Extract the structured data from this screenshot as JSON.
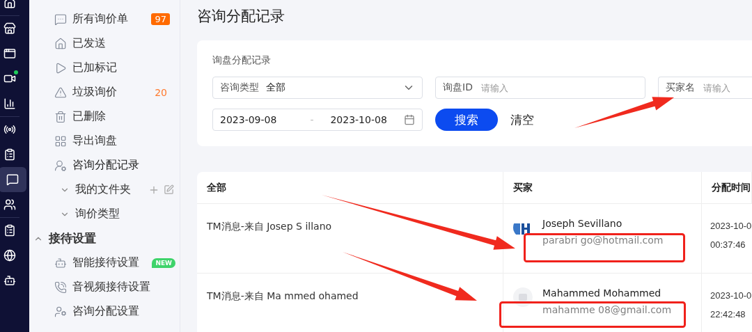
{
  "rail": {
    "items": [
      {
        "selected": false,
        "dot": false
      },
      {
        "selected": false,
        "dot": false
      },
      {
        "selected": false,
        "dot": false
      },
      {
        "selected": false,
        "dot": true
      },
      {
        "selected": false,
        "dot": false
      },
      {
        "selected": false,
        "dot": false
      },
      {
        "selected": false,
        "dot": false
      },
      {
        "selected": true,
        "dot": false
      },
      {
        "selected": false,
        "dot": false
      },
      {
        "selected": false,
        "dot": false
      },
      {
        "selected": false,
        "dot": false
      },
      {
        "selected": false,
        "dot": false
      }
    ]
  },
  "sidebar": {
    "items": [
      {
        "kind": "item",
        "label": "所有询价单",
        "count": {
          "text": "97",
          "kind": "badge"
        },
        "selected": false
      },
      {
        "kind": "item",
        "label": "已发送",
        "selected": false
      },
      {
        "kind": "item",
        "label": "已加标记",
        "selected": false
      },
      {
        "kind": "item",
        "label": "垃圾询价",
        "count": {
          "text": "20",
          "kind": "plain"
        },
        "selected": false
      },
      {
        "kind": "item",
        "label": "已删除",
        "selected": false
      },
      {
        "kind": "item",
        "label": "导出询盘",
        "selected": false
      },
      {
        "kind": "item",
        "label": "咨询分配记录",
        "selected": true
      },
      {
        "kind": "folder",
        "label": "我的文件夹",
        "expanded": false,
        "actions": true
      },
      {
        "kind": "folder",
        "label": "询价类型",
        "expanded": false,
        "actions": false
      },
      {
        "kind": "section",
        "label": "接待设置",
        "expanded": true
      },
      {
        "kind": "item",
        "label": "智能接待设置",
        "tag": "NEW",
        "selected": false
      },
      {
        "kind": "item",
        "label": "音视频接待设置",
        "selected": false
      },
      {
        "kind": "item",
        "label": "咨询分配设置",
        "selected": false
      }
    ]
  },
  "page_title": "咨询分配记录",
  "filters": {
    "title": "询盘分配记录",
    "type_select": {
      "label": "咨询类型",
      "value": "全部"
    },
    "id_field": {
      "label": "询盘ID",
      "placeholder": "请输入"
    },
    "buyer_field": {
      "label": "买家名",
      "placeholder": "请输入"
    },
    "date_range": {
      "start": "2023-09-08",
      "separator": "-",
      "end": "2023-10-08"
    },
    "search_button": "搜索",
    "clear_button": "清空"
  },
  "table": {
    "columns": [
      "全部",
      "买家",
      "分配时间"
    ],
    "rows": [
      {
        "subject": "TM消息-来自 Josep S illano",
        "buyer_name": "Joseph Sevillano",
        "buyer_email": "parabri go@hotmail.com",
        "avatar": {
          "kind": "logo"
        },
        "date": "2023-10-0",
        "time": "00:37:46"
      },
      {
        "subject": "TM消息-来自 Ma mmed ohamed",
        "buyer_name": "Mahammed Mohammed",
        "buyer_email": "mahamme 08@gmail.com",
        "avatar": {
          "kind": "placeholder"
        },
        "date": "2023-10-0",
        "time": "22:42:48"
      }
    ]
  },
  "annotations": [
    {
      "kind": "arrow"
    },
    {
      "kind": "arrow"
    },
    {
      "kind": "arrow"
    },
    {
      "kind": "box"
    },
    {
      "kind": "box"
    }
  ]
}
